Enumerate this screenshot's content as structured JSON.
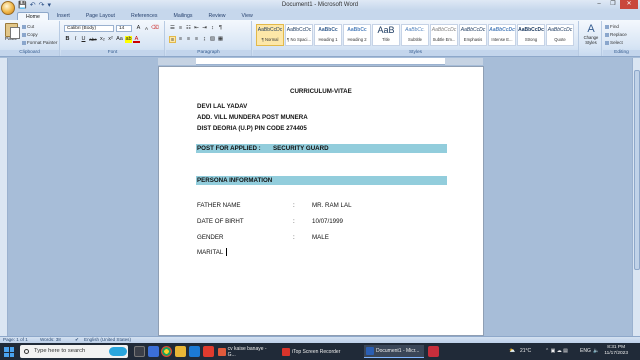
{
  "window": {
    "title": "Document1 - Microsoft Word",
    "controls": {
      "minimize": "–",
      "maximize": "❐",
      "close": "✕"
    }
  },
  "quick_access": [
    "💾",
    "↶",
    "↷",
    "▾"
  ],
  "ribbon": {
    "tabs": [
      "Home",
      "Insert",
      "Page Layout",
      "References",
      "Mailings",
      "Review",
      "View"
    ],
    "active_tab": "Home",
    "clipboard": {
      "paste": "Paste",
      "cut": "Cut",
      "copy": "Copy",
      "format_painter": "Format Painter",
      "label": "Clipboard"
    },
    "font": {
      "family": "Calibri (Body)",
      "size": "14",
      "buttons": [
        "B",
        "I",
        "U",
        "abe",
        "x₂",
        "x²",
        "Aa",
        "A"
      ],
      "label": "Font"
    },
    "paragraph": {
      "label": "Paragraph"
    },
    "styles": {
      "items": [
        {
          "preview": "AaBbCcDc",
          "name": "¶ Normal"
        },
        {
          "preview": "AaBbCcDc",
          "name": "¶ No Spaci..."
        },
        {
          "preview": "AaBbCc",
          "name": "Heading 1"
        },
        {
          "preview": "AaBbCc",
          "name": "Heading 2"
        },
        {
          "preview": "AaB",
          "name": "Title"
        },
        {
          "preview": "AaBbCc.",
          "name": "Subtitle"
        },
        {
          "preview": "AaBbCcDc",
          "name": "Subtle Em..."
        },
        {
          "preview": "AaBbCcDc",
          "name": "Emphasis"
        },
        {
          "preview": "AaBbCcDc",
          "name": "Intense E..."
        },
        {
          "preview": "AaBbCcDc",
          "name": "Strong"
        },
        {
          "preview": "AaBbCcDc",
          "name": "Quote"
        }
      ],
      "label": "Styles",
      "change_styles": "Change Styles"
    },
    "editing": {
      "find": "Find",
      "replace": "Replace",
      "select": "Select",
      "label": "Editing"
    }
  },
  "document": {
    "heading": "CURRICULUM-VITAE",
    "name": "DEVI LAL YADAV",
    "address1": "ADD. VILL MUNDERA POST MUNERA",
    "address2": "DIST DEORIA (U.P) PIN CODE 274405",
    "post_label": "POST FOR APPLIED   :",
    "post_value": "SECURITY GUARD",
    "section": "PERSONA INFORMATION",
    "fields": [
      {
        "label": "FATHER NAME",
        "sep": ":",
        "value": "MR. RAM LAL"
      },
      {
        "label": "DATE OF BIRHT",
        "sep": ":",
        "value": "10/07/1999"
      },
      {
        "label": "GENDER",
        "sep": ":",
        "value": "MALE"
      },
      {
        "label": "MARITAL",
        "sep": "",
        "value": ""
      }
    ]
  },
  "status": {
    "page": "Page: 1 of 1",
    "words": "Words: 38",
    "language": "English (United States)"
  },
  "taskbar": {
    "search_placeholder": "Type here to search",
    "apps": [
      {
        "label": "cv kaise banaye - G...",
        "color": "#e05a3c"
      },
      {
        "label": "iTop Screen Recorder",
        "color": "#d9342b"
      },
      {
        "label": "Document1 - Micr...",
        "color": "#2b5fb4"
      }
    ],
    "weather": "21°C",
    "language": "ENG",
    "time": "8:31 PM",
    "date": "11/17/2023"
  }
}
